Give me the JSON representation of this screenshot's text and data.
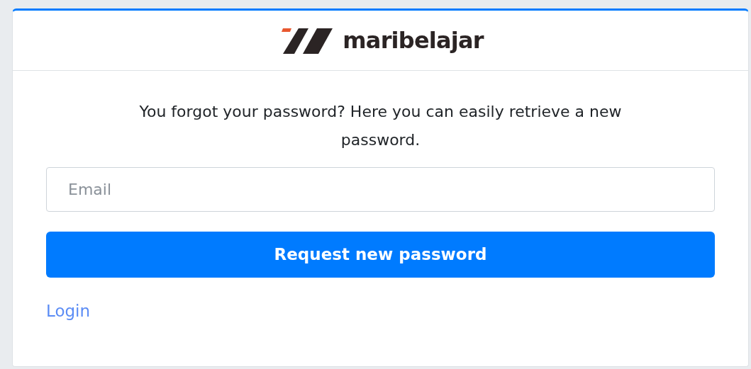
{
  "logo": {
    "text": "maribelajar"
  },
  "message": "You forgot your password? Here you can easily retrieve a new password.",
  "email": {
    "placeholder": "Email"
  },
  "submit_button": "Request new password",
  "login_link": "Login"
}
